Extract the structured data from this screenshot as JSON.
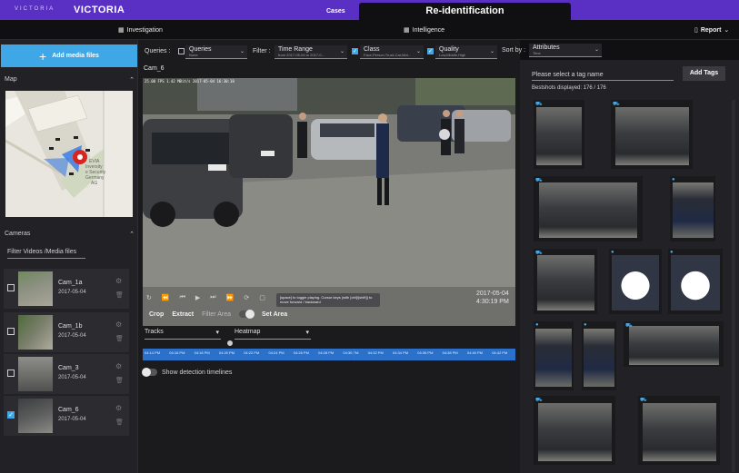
{
  "app": {
    "logo": "VICTORIA",
    "title": "VICTORIA",
    "tab_cases": "Cases",
    "tab_active": "Re-identification"
  },
  "subnav": {
    "investigation": "Investigation",
    "intelligence": "Intelligence",
    "report": "Report"
  },
  "left": {
    "add_media": "Add media files",
    "map_label": "Map",
    "cameras_label": "Cameras",
    "filter_placeholder": "Filter Videos /Media files",
    "map_text": "EVIA | Inversity | e Security | Germany | AG",
    "cameras": [
      {
        "name": "Cam_1a",
        "date": "2017-05-04",
        "checked": false
      },
      {
        "name": "Cam_1b",
        "date": "2017-05-04",
        "checked": false
      },
      {
        "name": "Cam_3",
        "date": "2017-05-04",
        "checked": false
      },
      {
        "name": "Cam_6",
        "date": "2017-05-04",
        "checked": true
      }
    ]
  },
  "query": {
    "queries_label": "Queries :",
    "queries_value": "Queries",
    "queries_sub": "None",
    "filter_label": "Filter :",
    "time_range": "Time Range",
    "time_range_sub": "from 2017-05-04 to 2017-0...",
    "class": "Class",
    "class_sub": "Face,Person,Truck,Car,Mot...",
    "quality": "Quality",
    "quality_sub": "Low,Middle,High",
    "sort_label": "Sort by :",
    "sort_value": "Attributes",
    "sort_sub": "Time"
  },
  "video": {
    "camera_title": "Cam_6",
    "osd": "25.00 FPS   1.42 MBit/s  2017-05-04 16:30:18",
    "tooltip": "[space] to toggle playing. Cursor keys (with [ctrl]/[shift]) to move forward / backward",
    "date": "2017-05-04",
    "time": "4:30:19 PM",
    "crop": "Crop",
    "extract": "Extract",
    "filter_area": "Filter Area",
    "set_area": "Set Area",
    "tracks": "Tracks",
    "heatmap": "Heatmap",
    "timeline_ticks": [
      "04:14 PM",
      "04:16 PM",
      "04:18 PM",
      "04:20 PM",
      "04:22 PM",
      "04:24 PM",
      "04:26 PM",
      "04:28 PM",
      "04:30 PM",
      "04:32 PM",
      "04:34 PM",
      "04:36 PM",
      "04:38 PM",
      "04:40 PM",
      "04:42 PM"
    ],
    "show_detection": "Show detection timelines"
  },
  "right": {
    "tag_placeholder": "Please select a tag name",
    "add_tags": "Add Tags",
    "bestshots": "Bestshots displayed: 176 / 176"
  },
  "colors": {
    "brand": "#5a2fc4",
    "accent": "#3fa7e6",
    "timeline": "#2b71c9"
  }
}
